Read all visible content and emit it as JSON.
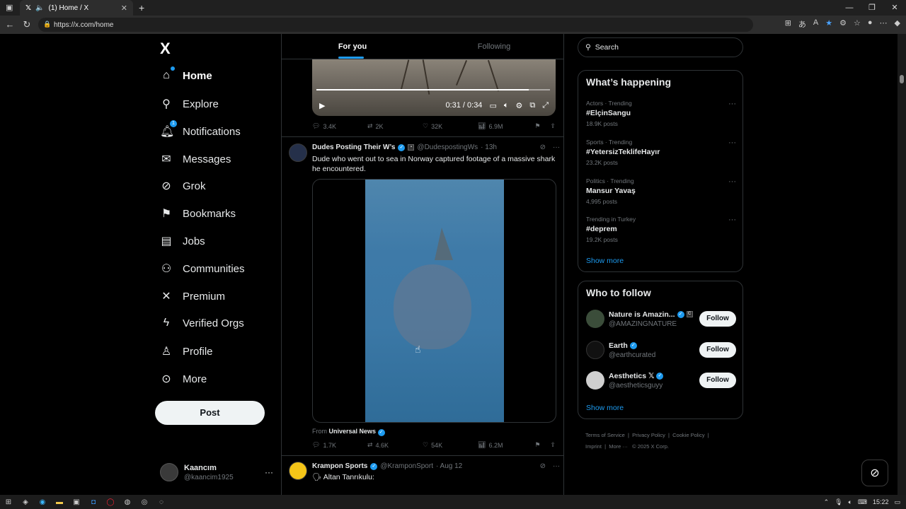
{
  "browser": {
    "tab_title": "(1) Home / X",
    "url": "https://x.com/home",
    "close_tab": "✕",
    "new_tab": "+"
  },
  "sidebar": {
    "logo": "X",
    "items": [
      {
        "label": "Home",
        "icon": "home-icon"
      },
      {
        "label": "Explore",
        "icon": "search-icon"
      },
      {
        "label": "Notifications",
        "icon": "bell-icon",
        "badge": "1"
      },
      {
        "label": "Messages",
        "icon": "envelope-icon"
      },
      {
        "label": "Grok",
        "icon": "grok-icon"
      },
      {
        "label": "Bookmarks",
        "icon": "bookmark-icon"
      },
      {
        "label": "Jobs",
        "icon": "briefcase-icon"
      },
      {
        "label": "Communities",
        "icon": "people-icon"
      },
      {
        "label": "Premium",
        "icon": "x-icon"
      },
      {
        "label": "Verified Orgs",
        "icon": "lightning-icon"
      },
      {
        "label": "Profile",
        "icon": "person-icon"
      },
      {
        "label": "More",
        "icon": "more-circle-icon"
      }
    ],
    "post_label": "Post",
    "account": {
      "name": "Kaancım",
      "handle": "@kaancim1925"
    }
  },
  "timeline": {
    "tabs": [
      "For you",
      "Following"
    ],
    "video1": {
      "time": "0:31 / 0:34",
      "progress": 0.91
    },
    "tweet1_actions": {
      "replies": "3.4K",
      "reposts": "2K",
      "likes": "32K",
      "views": "6.9M"
    },
    "tweet2": {
      "name": "Dudes Posting Their W’s",
      "handle": "@DudespostingWs",
      "time": "· 13h",
      "text": "Dude who went out to sea in Norway captured footage of a massive shark he encountered.",
      "from_prefix": "From",
      "from_source": "Universal News",
      "actions": {
        "replies": "1.7K",
        "reposts": "4.6K",
        "likes": "54K",
        "views": "6.2M"
      }
    },
    "tweet3": {
      "name": "Krampon Sports",
      "handle": "@KramponSport",
      "time": "· Aug 12",
      "text": "Altan Tanrıkulu:"
    }
  },
  "right": {
    "search_placeholder": "Search",
    "happening_title": "What’s happening",
    "trends": [
      {
        "context": "Actors · Trending",
        "topic": "#ElçinSangu",
        "posts": "18.9K posts"
      },
      {
        "context": "Sports · Trending",
        "topic": "#YetersizTeklifeHayır",
        "posts": "23.2K posts"
      },
      {
        "context": "Politics · Trending",
        "topic": "Mansur Yavaş",
        "posts": "4,995 posts"
      },
      {
        "context": "Trending in Turkey",
        "topic": "#deprem",
        "posts": "19.2K posts"
      }
    ],
    "show_more": "Show more",
    "who_title": "Who to follow",
    "who": [
      {
        "name": "Nature is Amazin...",
        "handle": "@AMAZINGNATURE",
        "follow": "Follow"
      },
      {
        "name": "Earth",
        "handle": "@earthcurated",
        "follow": "Follow"
      },
      {
        "name": "Aesthetics 𝕏",
        "handle": "@aestheticsguyy",
        "follow": "Follow"
      }
    ],
    "footer": {
      "terms": "Terms of Service",
      "privacy": "Privacy Policy",
      "cookie": "Cookie Policy",
      "imprint": "Imprint",
      "more": "More ···",
      "copyright": "© 2025 X Corp."
    }
  },
  "taskbar": {
    "clock": "15:22"
  }
}
